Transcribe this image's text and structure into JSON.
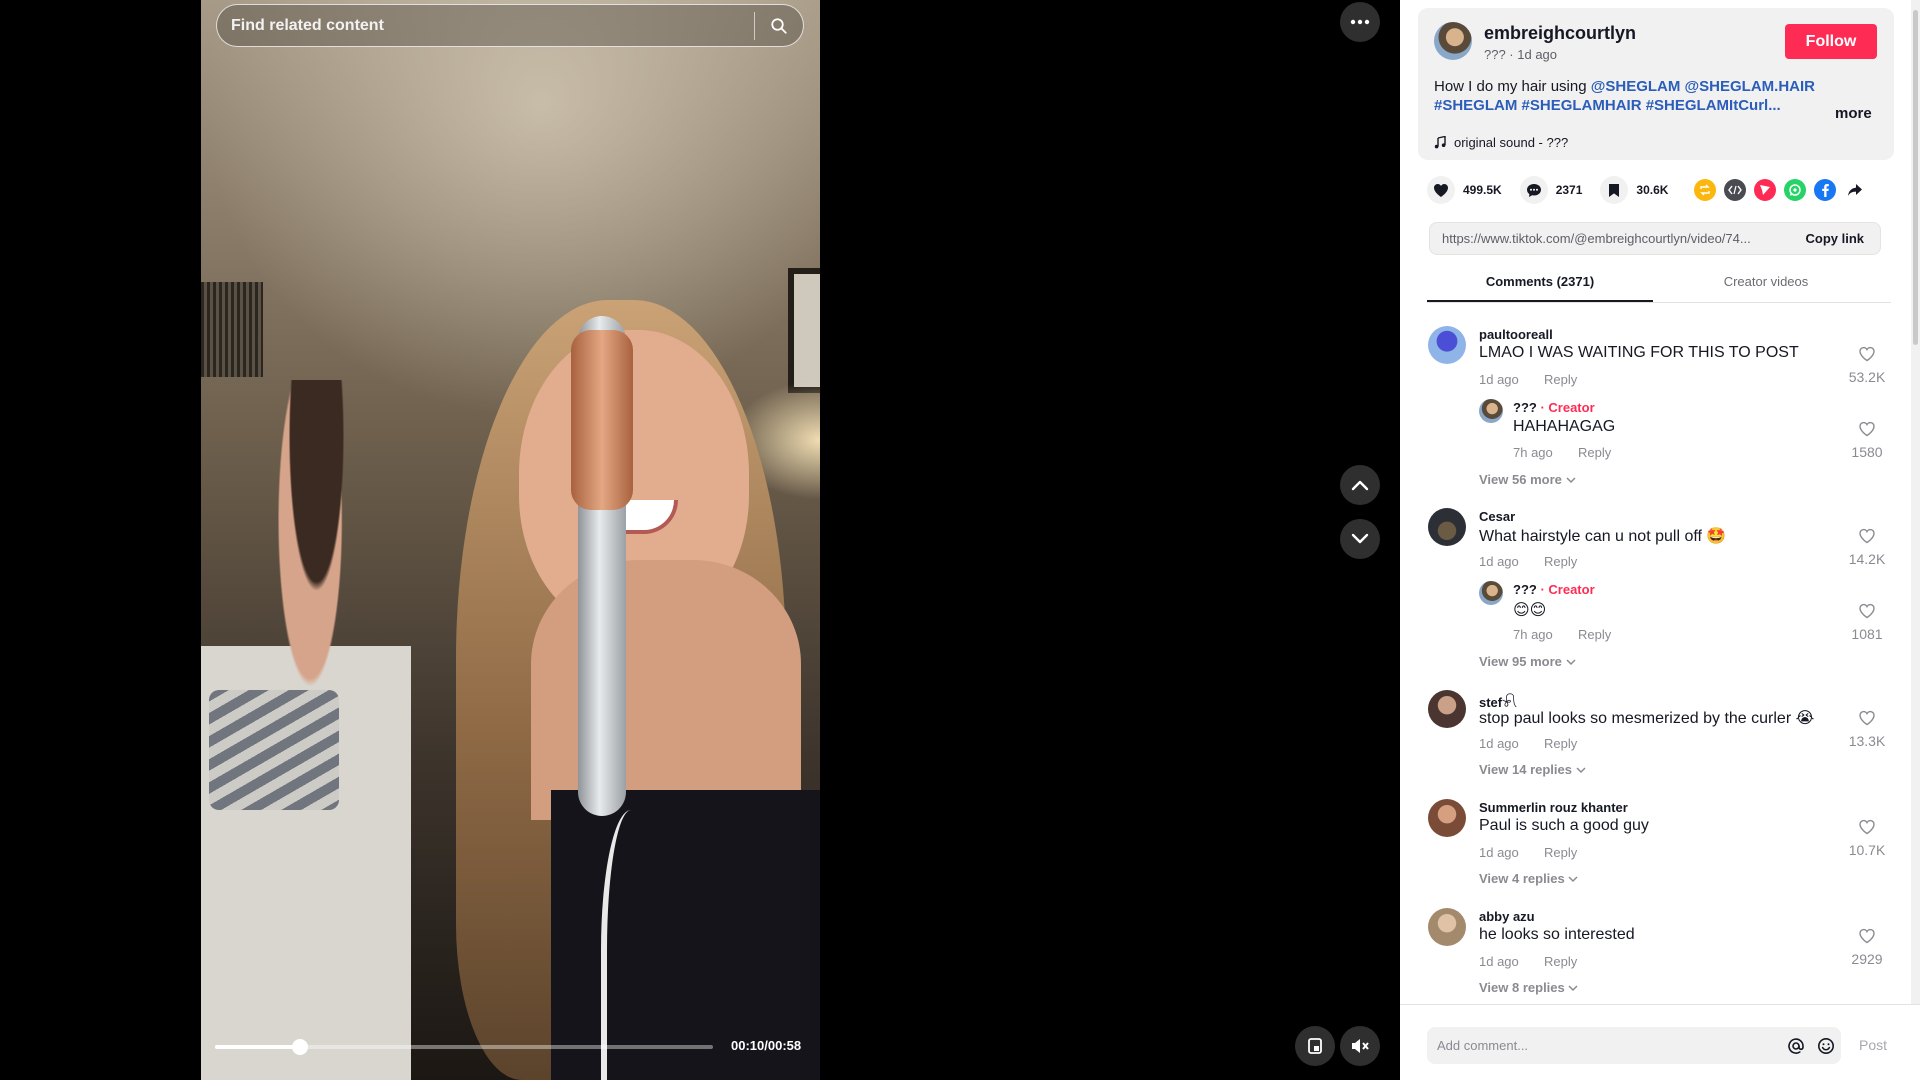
{
  "search": {
    "placeholder": "Find related content"
  },
  "player": {
    "time": "00:10/00:58",
    "progress": 0.17
  },
  "author": {
    "name": "embreighcourtlyn",
    "meta": "??? · 1d ago",
    "follow_label": "Follow"
  },
  "description": {
    "prefix": "How I do my hair using ",
    "tags": [
      "@SHEGLAM",
      "@SHEGLAM.HAIR",
      "#SHEGLAM",
      "#SHEGLAMHAIR",
      "#SHEGLAMItCurl..."
    ],
    "more_label": "more",
    "sound": "original sound - ???"
  },
  "stats": {
    "likes": "499.5K",
    "comments": "2371",
    "saves": "30.6K"
  },
  "share_colors": {
    "repost": "#fcb70f",
    "embed": "#4a4b52",
    "send": "#fe2c55",
    "whatsapp": "#25d366",
    "facebook": "#1877f2"
  },
  "link": {
    "url": "https://www.tiktok.com/@embreighcourtlyn/video/74...",
    "copy_label": "Copy link"
  },
  "tabs": {
    "comments": "Comments (2371)",
    "creator": "Creator videos"
  },
  "comments": [
    {
      "user": "paultooreall",
      "text": "LMAO I WAS WAITING FOR THIS TO POST",
      "date": "1d ago",
      "reply_label": "Reply",
      "likes": "53.2K",
      "avatar_color": "#3f6fc6",
      "reply": {
        "name": "???",
        "creator_tag": "· Creator",
        "text": "HAHAHAGAG",
        "date": "7h ago",
        "reply_label": "Reply",
        "likes": "1580"
      },
      "more": "View 56 more"
    },
    {
      "user": "Cesar",
      "text": "What hairstyle can u not pull off 🤩",
      "date": "1d ago",
      "reply_label": "Reply",
      "likes": "14.2K",
      "avatar_color": "#2c2f36",
      "reply": {
        "name": "???",
        "creator_tag": "· Creator",
        "text": "😊😊",
        "date": "7h ago",
        "reply_label": "Reply",
        "likes": "1081"
      },
      "more": "View 95 more"
    },
    {
      "user": "stef𓍯",
      "text": "stop paul looks so mesmerized by the curler 😭",
      "date": "1d ago",
      "reply_label": "Reply",
      "likes": "13.3K",
      "avatar_color": "#6b4b3e",
      "more": "View 14 replies"
    },
    {
      "user": "Summerlin rouz khanter",
      "text": "Paul is such a good guy",
      "date": "1d ago",
      "reply_label": "Reply",
      "likes": "10.7K",
      "avatar_color": "#9a6a50",
      "more": "View 4 replies"
    },
    {
      "user": "abby azu",
      "text": "he looks so interested",
      "date": "1d ago",
      "reply_label": "Reply",
      "likes": "2929",
      "avatar_color": "#b9a58a",
      "more": "View 8 replies"
    }
  ],
  "composer": {
    "placeholder": "Add comment...",
    "post_label": "Post"
  }
}
